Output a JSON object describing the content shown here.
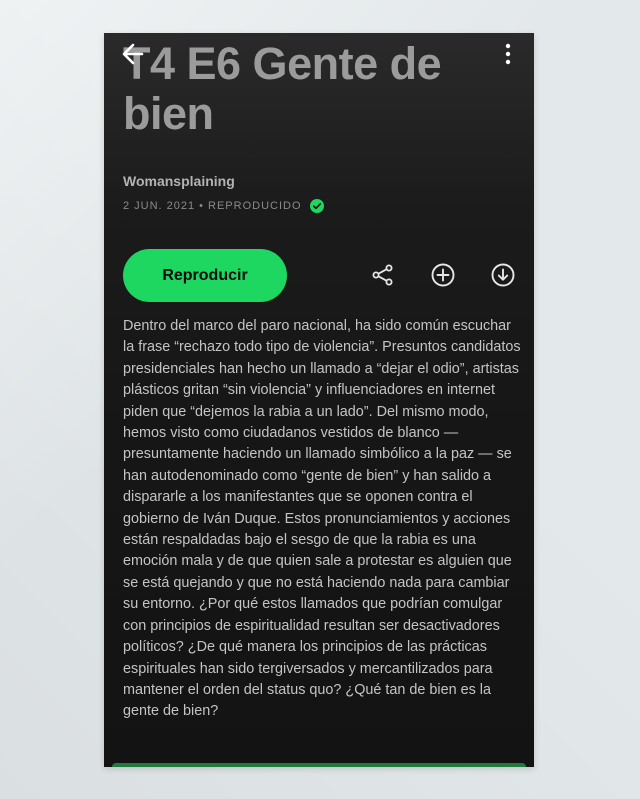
{
  "episode": {
    "title": "T4 E6 Gente de bien",
    "show_name": "Womansplaining",
    "date": "2 JUN. 2021",
    "separator": "•",
    "status": "REPRODUCIDO"
  },
  "actions": {
    "play_label": "Reproducir",
    "share_icon": "share-icon",
    "add_icon": "add-circle-icon",
    "download_icon": "download-icon"
  },
  "description": "Dentro del marco del paro nacional, ha sido común escuchar la frase “rechazo todo tipo de violencia”. Presuntos candidatos presidenciales han hecho un llamado a “dejar el odio”, artistas plásticos gritan “sin violencia” y influenciadores en internet piden que “dejemos la rabia a un lado”. Del mismo modo, hemos visto como ciudadanos vestidos de blanco — presuntamente haciendo un llamado simbólico a la paz — se han autodenominado como “gente de bien” y han salido a dispararle a los manifestantes que se oponen contra el gobierno de Iván Duque. Estos pronunciamientos y acciones están respaldadas bajo el sesgo de que la rabia es una emoción mala y de que quien sale a protestar es alguien que se está quejando y que no está haciendo nada para cambiar su entorno. ¿Por qué estos llamados que podrían comulgar con principios de espiritualidad resultan ser desactivadores políticos? ¿De qué manera los principios de las prácticas espirituales han sido tergiversados y mercantilizados para mantener el orden del status quo? ¿Qué tan de bien es la gente de bien?",
  "colors": {
    "accent": "#1ed760",
    "background": "#181818",
    "title_text": "#9b9b9b",
    "body_text": "#c4c4c4"
  }
}
